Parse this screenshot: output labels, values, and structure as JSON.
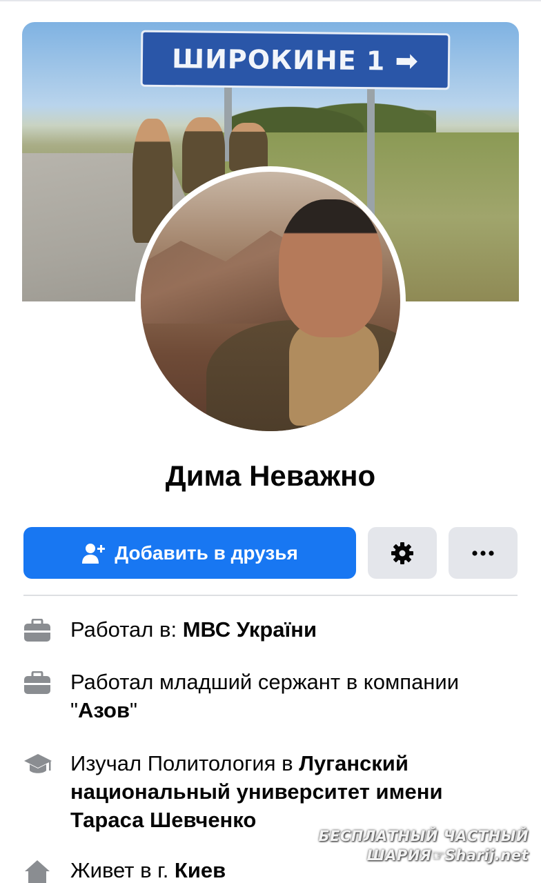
{
  "cover": {
    "sign_text": "ШИРОКИНЕ 1",
    "sign_arrow": "➡"
  },
  "profile": {
    "name": "Дима Неважно"
  },
  "actions": {
    "add_friend_label": "Добавить в друзья",
    "more_label": "•••"
  },
  "colors": {
    "primary": "#1877f2",
    "secondary_button": "#e4e6eb",
    "icon_gray": "#8a8d91"
  },
  "info": [
    {
      "icon": "briefcase-icon",
      "prefix": "Работал в: ",
      "bold": "МВС України",
      "suffix": ""
    },
    {
      "icon": "briefcase-icon",
      "prefix": "Работал младший сержант в компании \"",
      "bold": "Азов",
      "suffix": "\""
    },
    {
      "icon": "graduation-cap-icon",
      "prefix": "Изучал Политология в ",
      "bold": "Луганский национальный университет имени Тараса Шевченко",
      "suffix": ""
    },
    {
      "icon": "home-icon",
      "prefix": "Живет в г. ",
      "bold": "Киев",
      "suffix": ""
    }
  ],
  "watermark": {
    "line1": "БЕСПЛАТНЫЙ ЧАСТНЫЙ",
    "line2": "ШАРИЯ☞Sharij.net"
  }
}
